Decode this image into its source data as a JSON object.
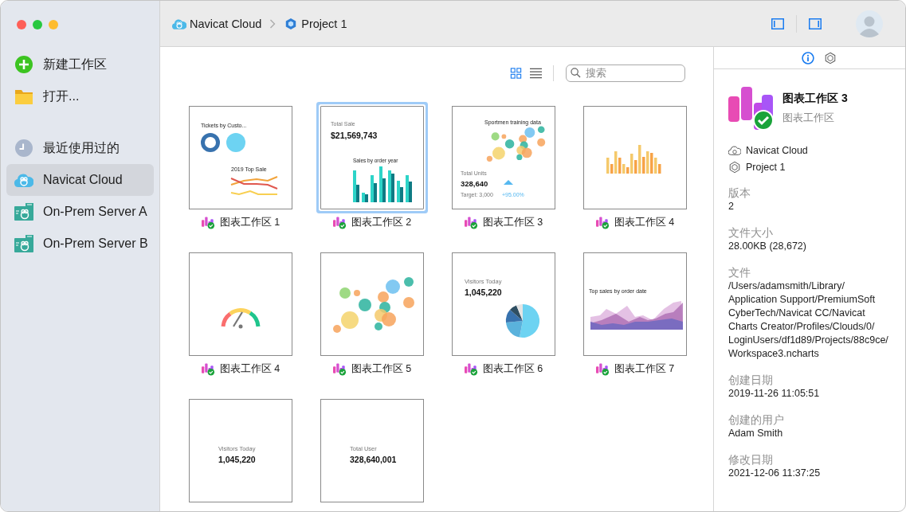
{
  "sidebar": {
    "items": [
      {
        "kind": "new",
        "label": "新建工作区",
        "selected": false
      },
      {
        "kind": "open",
        "label": "打开...",
        "selected": false
      },
      {
        "kind": "recent",
        "label": "最近使用过的",
        "selected": false
      },
      {
        "kind": "cloud",
        "label": "Navicat Cloud",
        "selected": true
      },
      {
        "kind": "server",
        "label": "On-Prem Server A",
        "selected": false
      },
      {
        "kind": "server",
        "label": "On-Prem Server B",
        "selected": false
      }
    ]
  },
  "breadcrumb": [
    {
      "kind": "cloud",
      "label": "Navicat Cloud"
    },
    {
      "kind": "project",
      "label": "Project 1"
    }
  ],
  "toolbar": {
    "view_modes": [
      {
        "kind": "grid",
        "selected": true
      },
      {
        "kind": "list",
        "selected": false
      }
    ],
    "search": {
      "placeholder": "搜索"
    }
  },
  "workspaces": [
    {
      "label": "图表工作区 1",
      "selected": false,
      "thumbnail": {
        "kind": "lines",
        "texts": [
          "Tickets by Custo...",
          "2019 Top Sale"
        ]
      }
    },
    {
      "label": "图表工作区 2",
      "selected": true,
      "thumbnail": {
        "kind": "bars",
        "texts": [
          "Total Sale",
          "$21,569,743",
          "Sales by order year"
        ]
      }
    },
    {
      "label": "图表工作区 3",
      "selected": false,
      "thumbnail": {
        "kind": "scatter",
        "texts": [
          "Sportmen training data",
          "Total Units",
          "328,640",
          "Target: 3,000",
          "+95.00%"
        ]
      }
    },
    {
      "label": "图表工作区 4",
      "selected": false,
      "thumbnail": {
        "kind": "columns"
      }
    },
    {
      "label": "图表工作区 4",
      "selected": false,
      "thumbnail": {
        "kind": "gauge"
      }
    },
    {
      "label": "图表工作区 5",
      "selected": false,
      "thumbnail": {
        "kind": "bubbles"
      }
    },
    {
      "label": "图表工作区 6",
      "selected": false,
      "thumbnail": {
        "kind": "pie",
        "texts": [
          "Visitors Today",
          "1,045,220"
        ]
      }
    },
    {
      "label": "图表工作区 7",
      "selected": false,
      "thumbnail": {
        "kind": "area",
        "texts": [
          "Top sales by order date"
        ]
      }
    },
    {
      "selected": false,
      "thumbnail": {
        "kind": "kpi",
        "texts": [
          "Visitors Today",
          "1,045,220"
        ]
      }
    },
    {
      "selected": false,
      "thumbnail": {
        "kind": "kpi",
        "texts": [
          "Total User",
          "328,640,001"
        ]
      }
    }
  ],
  "inspector": {
    "tabs": [
      {
        "kind": "info",
        "selected": true
      },
      {
        "kind": "project",
        "selected": false
      }
    ],
    "title": "图表工作区 3",
    "subtitle": "图表工作区",
    "location": [
      {
        "kind": "cloud",
        "label": "Navicat Cloud"
      },
      {
        "kind": "project",
        "label": "Project 1"
      }
    ],
    "fields": [
      {
        "label": "版本",
        "value": "2"
      },
      {
        "label": "文件大小",
        "value": "28.00KB (28,672)"
      },
      {
        "label": "文件",
        "value": "/Users/adamsmith/Library/Application Support/PremiumSoft CyberTech/Navicat CC/Navicat Charts Creator/Profiles/Clouds/0/LoginUsers/df1d89/Projects/88c9ce/Workspace3.ncharts"
      },
      {
        "label": "创建日期",
        "value": "2019-11-26 11:05:51"
      },
      {
        "label": "创建的用户",
        "value": "Adam Smith"
      },
      {
        "label": "修改日期",
        "value": "2021-12-06 11:37:25"
      }
    ]
  }
}
